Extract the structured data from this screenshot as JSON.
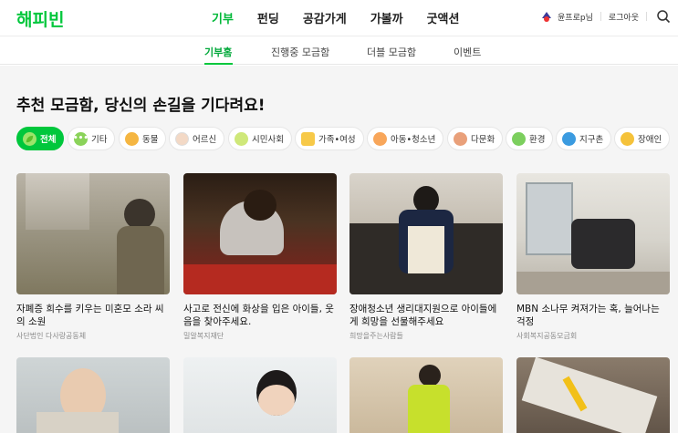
{
  "header": {
    "logo": "해피빈",
    "nav": [
      "기부",
      "펀딩",
      "공감가게",
      "가볼까",
      "굿액션"
    ],
    "active_nav": 0,
    "user_name": "윤프로p님",
    "logout": "로그아웃"
  },
  "subnav": {
    "items": [
      "기부홈",
      "진행중 모금함",
      "더블 모금함",
      "이벤트"
    ],
    "active": 0
  },
  "section": {
    "headline": "추천 모금함, 당신의 손길을 기다려요!"
  },
  "categories": [
    {
      "label": "전체",
      "icon": "leaf-icon",
      "selected": true
    },
    {
      "label": "기타",
      "icon": "dots-icon",
      "selected": false
    },
    {
      "label": "동물",
      "icon": "cat-icon",
      "selected": false
    },
    {
      "label": "어르신",
      "icon": "elder-icon",
      "selected": false
    },
    {
      "label": "시민사회",
      "icon": "pencil-icon",
      "selected": false
    },
    {
      "label": "가족•여성",
      "icon": "house-icon",
      "selected": false
    },
    {
      "label": "아동•청소년",
      "icon": "child-icon",
      "selected": false
    },
    {
      "label": "다문화",
      "icon": "handshake-icon",
      "selected": false
    },
    {
      "label": "환경",
      "icon": "sprout-icon",
      "selected": false
    },
    {
      "label": "지구촌",
      "icon": "globe-icon",
      "selected": false
    },
    {
      "label": "장애인",
      "icon": "wheelchair-icon",
      "selected": false
    }
  ],
  "cards": [
    {
      "title": "자폐증 희수를 키우는 미혼모 소라 씨의 소원",
      "org": "사단법인 다사랑공동체"
    },
    {
      "title": "사고로 전신에 화상을 입은 아이들, 웃음을 찾아주세요.",
      "org": "밀알복지재단"
    },
    {
      "title": "장애청소년 생리대지원으로 아이들에게 희망을 선물해주세요",
      "org": "희망을주는사람들"
    },
    {
      "title": "MBN 소나무 켜져가는 혹, 늘어나는 걱정",
      "org": "사회복지공동모금회"
    }
  ],
  "colors": {
    "brand": "#00c73c",
    "chip_bg": "#ffffff",
    "page_bg": "#f5f5f5"
  }
}
